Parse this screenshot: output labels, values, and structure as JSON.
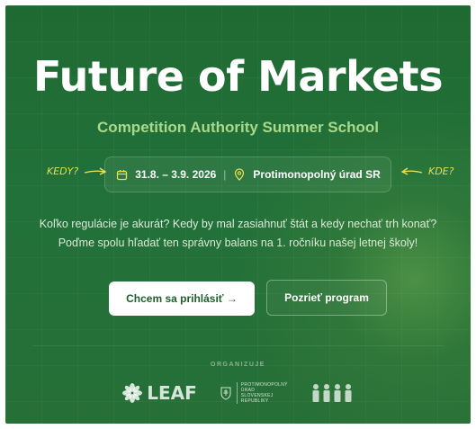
{
  "hero": {
    "title": "Future of Markets",
    "subtitle": "Competition Authority Summer School"
  },
  "info": {
    "dates": "31.8. – 3.9. 2026",
    "separator": "|",
    "location": "Protimonopolný úrad SR",
    "calendar_icon": "calendar-icon",
    "location_icon": "map-pin-icon"
  },
  "annotations": {
    "when": "KEDY?",
    "where": "KDE?"
  },
  "description": "Koľko regulácie je akurát? Kedy by mal zasiahnuť štát a kedy nechať trh konať? Poďme spolu hľadať ten správny balans na 1. ročníku našej letnej školy!",
  "buttons": {
    "primary": "Chcem sa prihlásiť  →",
    "secondary": "Pozrieť program"
  },
  "organizers": {
    "label": "ORGANIZUJE",
    "leaf": "LEAF",
    "amo_text": "PROTIMONOPOLNÝ\nÚRAD\nSLOVENSKEJ\nREPUBLIKY"
  },
  "colors": {
    "background": "#22713a",
    "accent": "#a9d98a",
    "handwriting": "#e8dd4a"
  }
}
